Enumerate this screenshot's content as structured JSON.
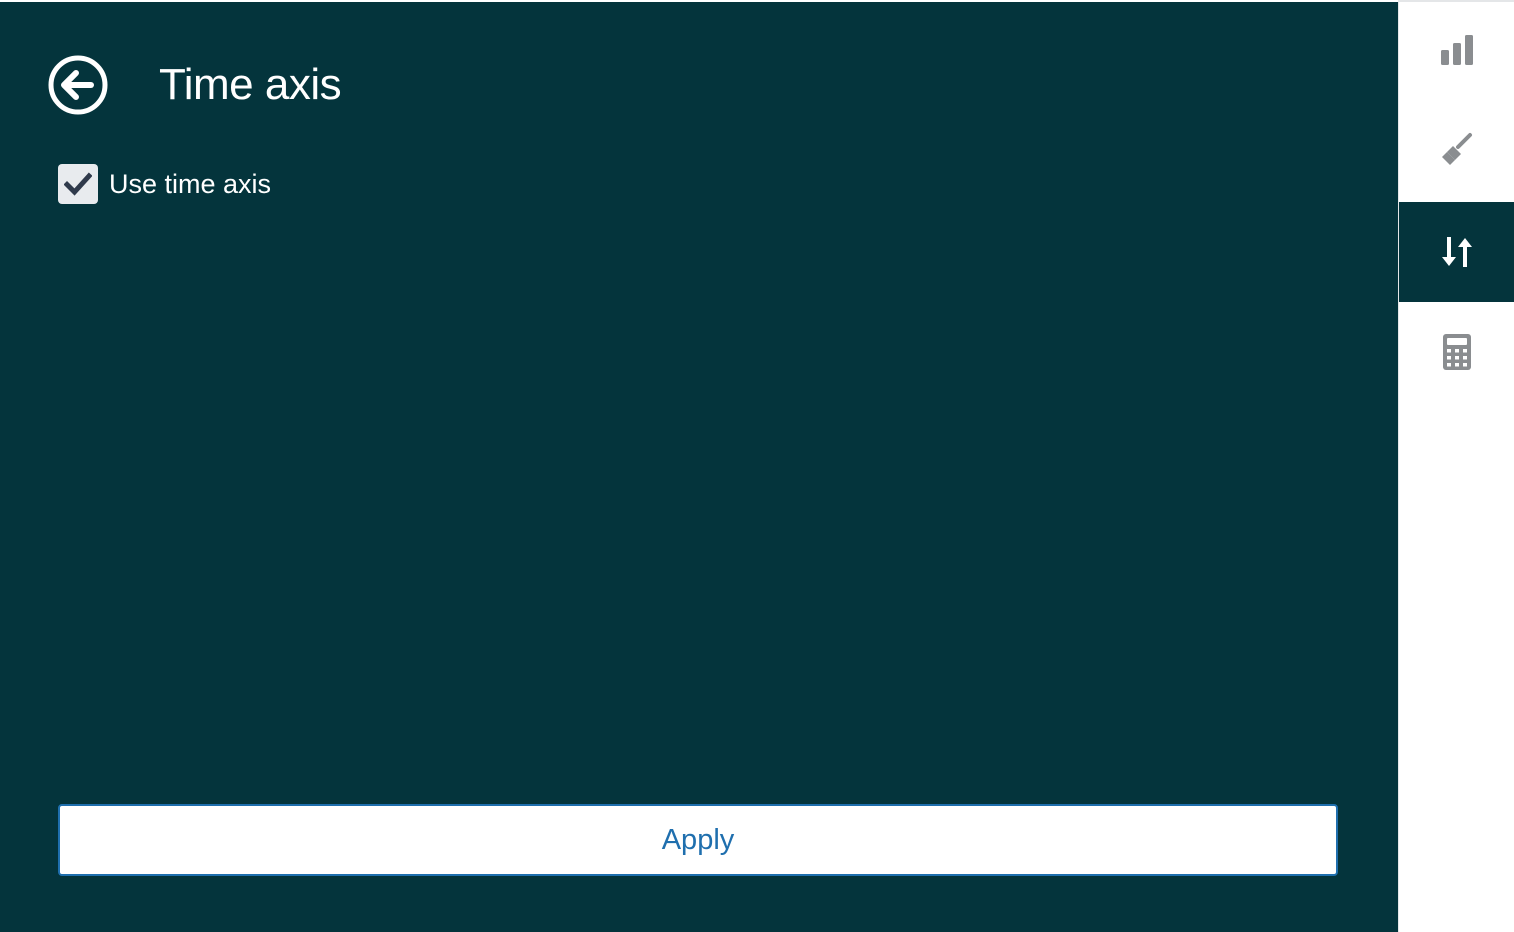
{
  "panel": {
    "title": "Time axis",
    "back_icon": "arrow-circle-left-icon",
    "background_color": "#04343c"
  },
  "options": {
    "use_time_axis": {
      "label": "Use time axis",
      "checked": true
    }
  },
  "actions": {
    "apply_label": "Apply",
    "apply_color": "#1f6fae"
  },
  "sidebar": {
    "tabs": [
      {
        "icon": "bar-chart-icon",
        "active": false
      },
      {
        "icon": "paint-brush-icon",
        "active": false
      },
      {
        "icon": "sort-arrows-icon",
        "active": true
      },
      {
        "icon": "calculator-icon",
        "active": false
      }
    ]
  }
}
